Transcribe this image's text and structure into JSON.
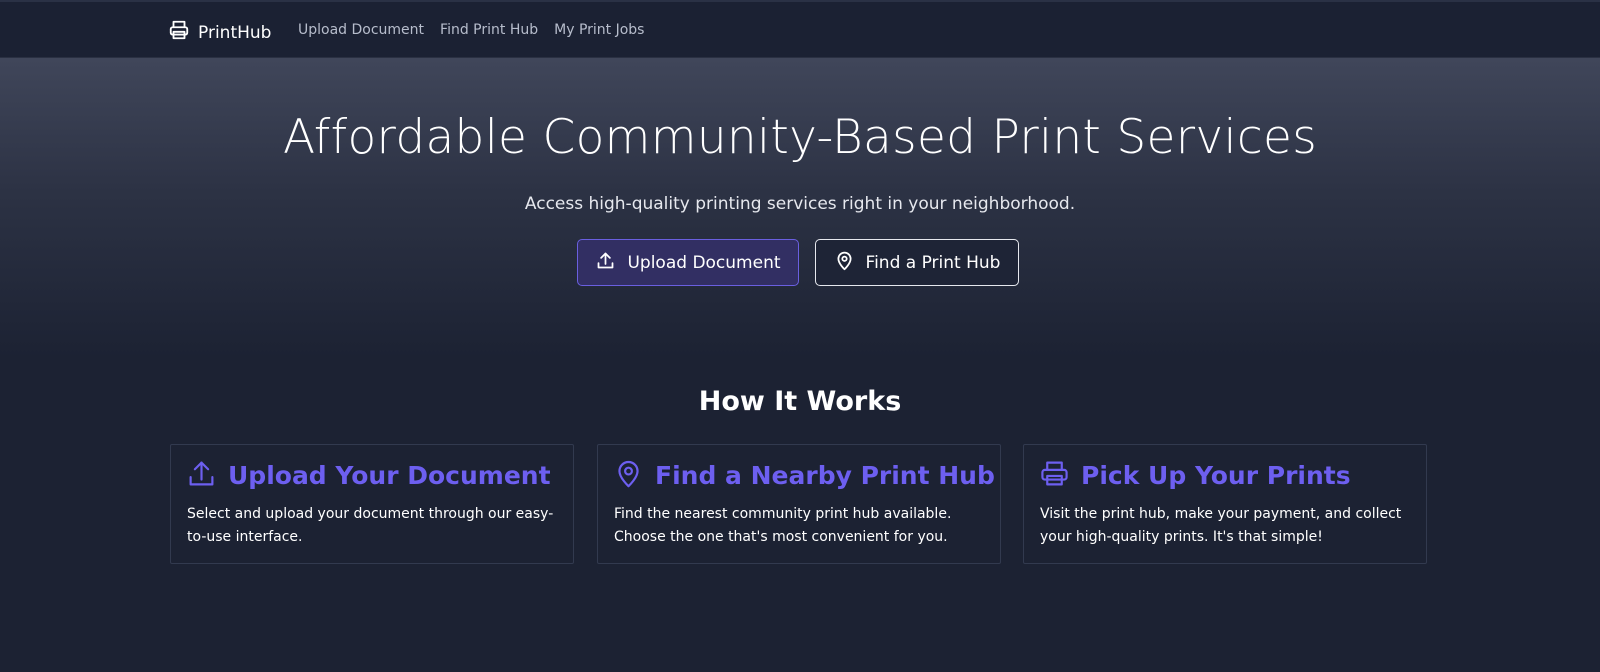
{
  "nav": {
    "brand": "PrintHub",
    "links": [
      "Upload Document",
      "Find Print Hub",
      "My Print Jobs"
    ]
  },
  "hero": {
    "title": "Affordable Community-Based Print Services",
    "subtitle": "Access high-quality printing services right in your neighborhood.",
    "upload_button": "Upload Document",
    "find_button": "Find a Print Hub"
  },
  "how": {
    "title": "How It Works",
    "steps": [
      {
        "icon": "upload-icon",
        "title": "Upload Your Document",
        "text": "Select and upload your document through our easy-to-use interface."
      },
      {
        "icon": "map-pin-icon",
        "title": "Find a Nearby Print Hub",
        "text": "Find the nearest community print hub available. Choose the one that's most convenient for you."
      },
      {
        "icon": "printer-icon",
        "title": "Pick Up Your Prints",
        "text": "Visit the print hub, make your payment, and collect your high-quality prints. It's that simple!"
      }
    ]
  },
  "colors": {
    "background": "#1c2233",
    "accent": "#6d5ff0",
    "accent_button_bg": "#322f63"
  }
}
